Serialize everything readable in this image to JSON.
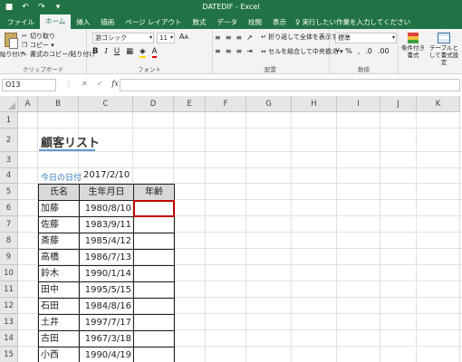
{
  "app": {
    "window_title": "DATEDIF  -  Excel",
    "quick_access": [
      "save-icon",
      "undo-icon",
      "redo-icon",
      "customize-icon"
    ]
  },
  "ribbon": {
    "tabs": [
      "ファイル",
      "ホーム",
      "挿入",
      "描画",
      "ページ レイアウト",
      "数式",
      "データ",
      "校閲",
      "表示"
    ],
    "active_tab": "ホーム",
    "tell_me": "実行したい作業を入力してください",
    "clipboard": {
      "paste": "貼り付け",
      "cut": "切り取り",
      "copy": "コピー",
      "format_painter": "書式のコピー/貼り付け",
      "label": "クリップボード"
    },
    "font": {
      "name": "游ゴシック",
      "size": "11",
      "label": "フォント"
    },
    "alignment": {
      "wrap": "折り返して全体を表示する",
      "merge": "セルを結合して中央揃え",
      "label": "配置"
    },
    "number": {
      "format": "標準",
      "label": "数値"
    },
    "styles": {
      "conditional": "条件付き書式",
      "table": "テーブルとして書式設定"
    }
  },
  "formula_bar": {
    "name_box": "O13",
    "fx": "fx",
    "value": ""
  },
  "grid": {
    "columns": [
      "A",
      "B",
      "C",
      "D",
      "E",
      "F",
      "G",
      "H",
      "I",
      "J",
      "K"
    ],
    "rows": [
      "1",
      "2",
      "3",
      "4",
      "5",
      "6",
      "7",
      "8",
      "9",
      "10",
      "11",
      "12",
      "13",
      "14",
      "15"
    ]
  },
  "sheet": {
    "title": "顧客リスト",
    "date_label": "今日の日付",
    "date_value": "2017/2/10",
    "headers": [
      "氏名",
      "生年月日",
      "年齢"
    ],
    "records": [
      {
        "name": "加藤",
        "dob": "1980/8/10",
        "age": ""
      },
      {
        "name": "佐藤",
        "dob": "1983/9/11",
        "age": ""
      },
      {
        "name": "斎藤",
        "dob": "1985/4/12",
        "age": ""
      },
      {
        "name": "高橋",
        "dob": "1986/7/13",
        "age": ""
      },
      {
        "name": "鈴木",
        "dob": "1990/1/14",
        "age": ""
      },
      {
        "name": "田中",
        "dob": "1995/5/15",
        "age": ""
      },
      {
        "name": "石田",
        "dob": "1984/8/16",
        "age": ""
      },
      {
        "name": "土井",
        "dob": "1997/7/17",
        "age": ""
      },
      {
        "name": "古田",
        "dob": "1967/3/18",
        "age": ""
      },
      {
        "name": "小西",
        "dob": "1990/4/19",
        "age": ""
      }
    ]
  },
  "colors": {
    "brand": "#217346",
    "selection": "#c00000",
    "header_fill": "#d9d9d9",
    "title_underline": "#5b9bd5"
  }
}
